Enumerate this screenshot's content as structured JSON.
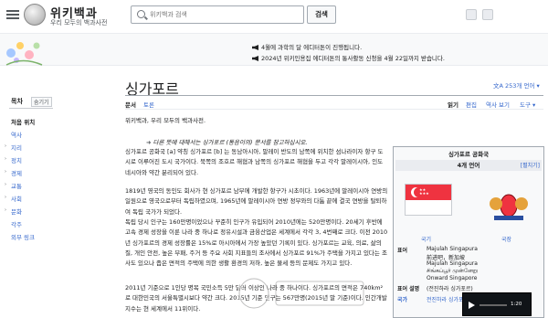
{
  "header": {
    "logo_title": "위키백과",
    "logo_tagline": "우리 모두의 백과사전",
    "search_placeholder": "위키백과 검색",
    "search_button": "검색"
  },
  "banner": {
    "line1": "4월에 과학의 달 에디터톤이 진행됩니다.",
    "line2": "2024년 위키인용집 에디터톤의 통사활동 신청을 4월 22일까지 받습니다."
  },
  "sidebar": {
    "heading": "목차",
    "hide_label": "숨기기",
    "items": [
      "처음 위치",
      "역사",
      "지리",
      "정치",
      "경제",
      "교통",
      "사회",
      "문화",
      "각주",
      "외부 링크"
    ]
  },
  "page": {
    "title": "싱가포르",
    "lang_button": "253개 언어",
    "tabs_left": [
      "문서",
      "토론"
    ],
    "tabs_right": [
      "읽기",
      "편집",
      "역사 보기",
      "도구"
    ],
    "from_line": "위키백과, 우리 모두의 백과사전.",
    "hatnote": "다른 뜻에 대해서는 싱가포르 (동음이의) 문서를 참고하십시오."
  },
  "paragraphs": [
    "싱가포르 공화국 [a] 약칭 싱가포르 [b] 는 동남아시아, 말레이 반도의 남쪽에 위치한 섬나라이자 항구 도시로 이루어진 도시 국가이다. 북쪽의 조호르 해협과 남쪽의 싱가포르 해협을 두고 각각 말레이시아, 인도네시아와 약간 분리되어 있다.",
    "1819년 영국의 동인도 회사가 현 싱가포르 남부에 개발한 항구가 시초이다. 1963년에 말레이시아 연방의 일원으로 영국으로부터 독립하였으며, 1965년에 말레이시아 연방 정부와의 다툼 끝에 결국 연방을 탈퇴하여 독립 국가가 되었다.",
    "독립 당시 인구는 160만명이었으나 꾸준히 인구가 유입되어 2010년에는 520만명이다. 20세기 후반에 고속 경제 성장을 이룬 나라 중 하나로 정유시설과 금융산업은 세계에서 각각 3, 4번째로 크다. 이전 2010년 싱가포르의 경제 성장률은 15%로 아시아에서 가장 높았던 기록이 있다. 싱가포르는 교육, 의료, 삶의 질, 개인 안전, 높은 부패, 주거 등 주요 사회 지표들의 조사에서 싱가포르 91%가 주택을 가지고 있다는 조사도 있으나 좁은 면적의 주택에 의한 생활 환경의 저하, 높은 물세 등의 문제도 가지고 있다.",
    "2011년 기준으로 1인당 명목 국민소득 5만 달러 이상인 나라 중 하나이다. 싱가포르의 면적은 740km²로 대한민국의 서울특별시보다 약간 크다. 2015년 기준 인구는 567만명(2015년 말 기준)이다. 인간개발지수는 현 세계에서 11위이다."
  ],
  "infobox": {
    "title": "싱가포르 공화국",
    "langs": "4개 언어",
    "edit": "[펼치기]",
    "flag_caption": "국기",
    "emblem_caption": "국장",
    "motto_label": "표어",
    "motto_lines": [
      "Majulah Singapura",
      "前进吧，新加坡",
      "Majulah Singapura",
      "சிங்கப்பூர் முன்னேறு",
      "Onward Singapore"
    ],
    "motto_kr_label": "표어 설명",
    "motto_kr": "(전진하라 싱가포르)",
    "anthem_label": "국가",
    "anthem": "전진하라 싱가포르",
    "player_time": "1:20"
  },
  "colors": {
    "link": "#3366cc",
    "flag_red": "#ef3340",
    "text": "#202122"
  }
}
